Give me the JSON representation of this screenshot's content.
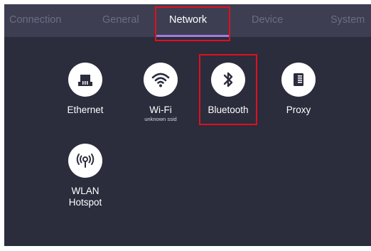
{
  "tabs": [
    {
      "label": "Connection",
      "active": false
    },
    {
      "label": "General",
      "active": false
    },
    {
      "label": "Network",
      "active": true
    },
    {
      "label": "Device",
      "active": false
    },
    {
      "label": "System",
      "active": false
    }
  ],
  "network_items": [
    {
      "label": "Ethernet",
      "icon": "ethernet-icon"
    },
    {
      "label": "Wi-Fi",
      "sublabel": "unknown ssid",
      "icon": "wifi-icon"
    },
    {
      "label": "Bluetooth",
      "icon": "bluetooth-icon"
    },
    {
      "label": "Proxy",
      "icon": "proxy-icon"
    },
    {
      "label": "WLAN\nHotspot",
      "icon": "hotspot-icon"
    }
  ],
  "colors": {
    "panel_background": "#2b2c3c",
    "tabbar_background": "#3d3e52",
    "active_tab_underline": "#9b7fe0",
    "highlight_box": "#e0101e",
    "icon_fill": "#2b2c3c"
  }
}
